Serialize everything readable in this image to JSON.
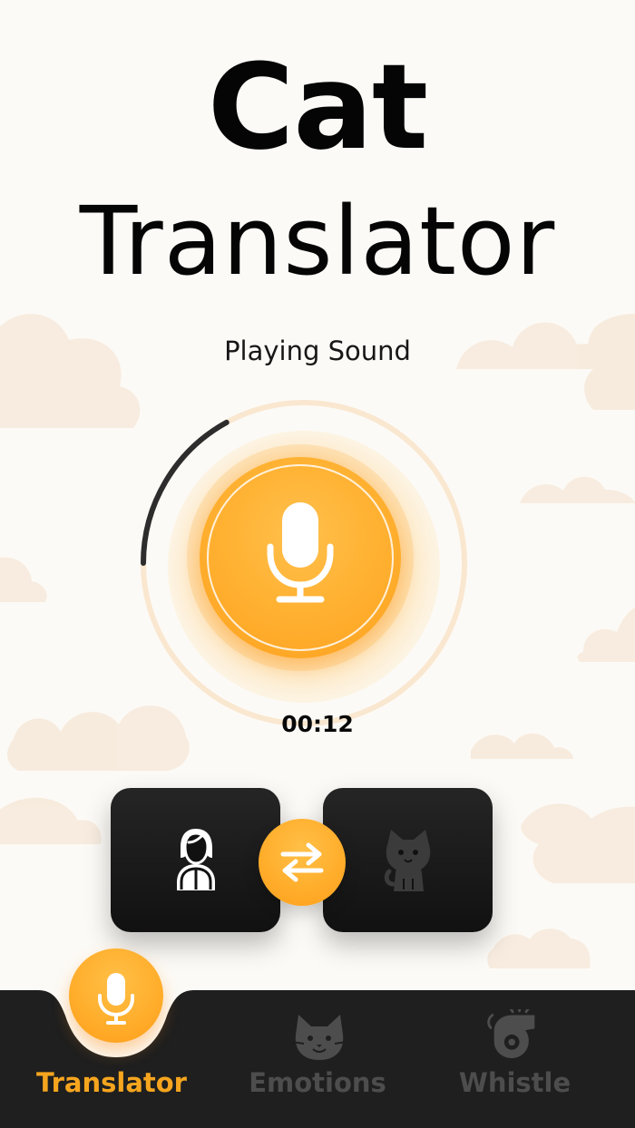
{
  "title": {
    "line1": "Cat",
    "line2": "Translator"
  },
  "recorder": {
    "status": "Playing Sound",
    "timer": "00:12",
    "progress": 0.34
  },
  "translator": {
    "source_icon": "woman-icon",
    "target_icon": "cat-icon",
    "swap_icon": "swap-arrows-icon"
  },
  "bottom_nav": {
    "items": [
      {
        "label": "Translator",
        "icon": "microphone-icon",
        "active": true
      },
      {
        "label": "Emotions",
        "icon": "cat-face-icon",
        "active": false
      },
      {
        "label": "Whistle",
        "icon": "whistle-icon",
        "active": false
      }
    ]
  },
  "colors": {
    "background": "#fcfaf6",
    "accent": "#ffac2b",
    "active_nav": "#f6a51f",
    "dark": "#111111",
    "inactive": "#4d4d4d",
    "cloud": "#f7ebdd"
  }
}
